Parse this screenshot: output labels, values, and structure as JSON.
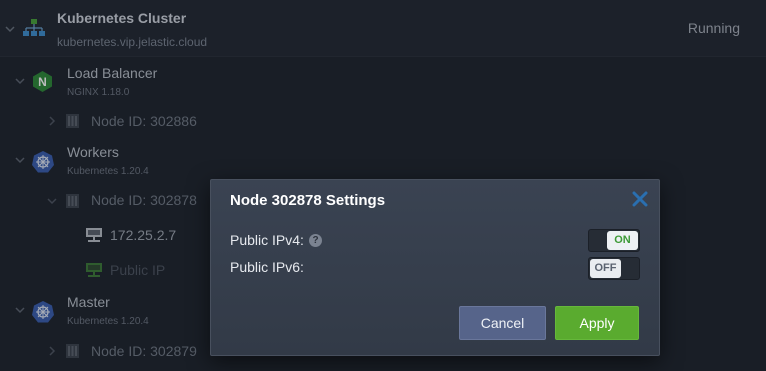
{
  "environment": {
    "title": "Kubernetes Cluster",
    "domain": "kubernetes.vip.jelastic.cloud",
    "status": "Running"
  },
  "layers": [
    {
      "name": "Load Balancer",
      "version": "NGINX 1.18.0",
      "node": "Node ID: 302886",
      "icon": "nginx-icon"
    },
    {
      "name": "Workers",
      "version": "Kubernetes 1.20.4",
      "node": "Node ID: 302878",
      "icon": "kubernetes-icon",
      "ip": "172.25.2.7",
      "public_ip_label": "Public IP"
    },
    {
      "name": "Master",
      "version": "Kubernetes 1.20.4",
      "node": "Node ID: 302879",
      "icon": "kubernetes-icon"
    }
  ],
  "dialog": {
    "title": "Node 302878 Settings",
    "ipv4_label": "Public IPv4:",
    "ipv6_label": "Public IPv6:",
    "help_glyph": "?",
    "ipv4_toggle": "ON",
    "ipv6_toggle": "OFF",
    "cancel_label": "Cancel",
    "apply_label": "Apply"
  },
  "colors": {
    "background": "#1f242e",
    "dialog": "#363e4b",
    "apply": "#5aab2f",
    "cancel": "#56648a",
    "toggle_on_text": "#3d9a36"
  }
}
